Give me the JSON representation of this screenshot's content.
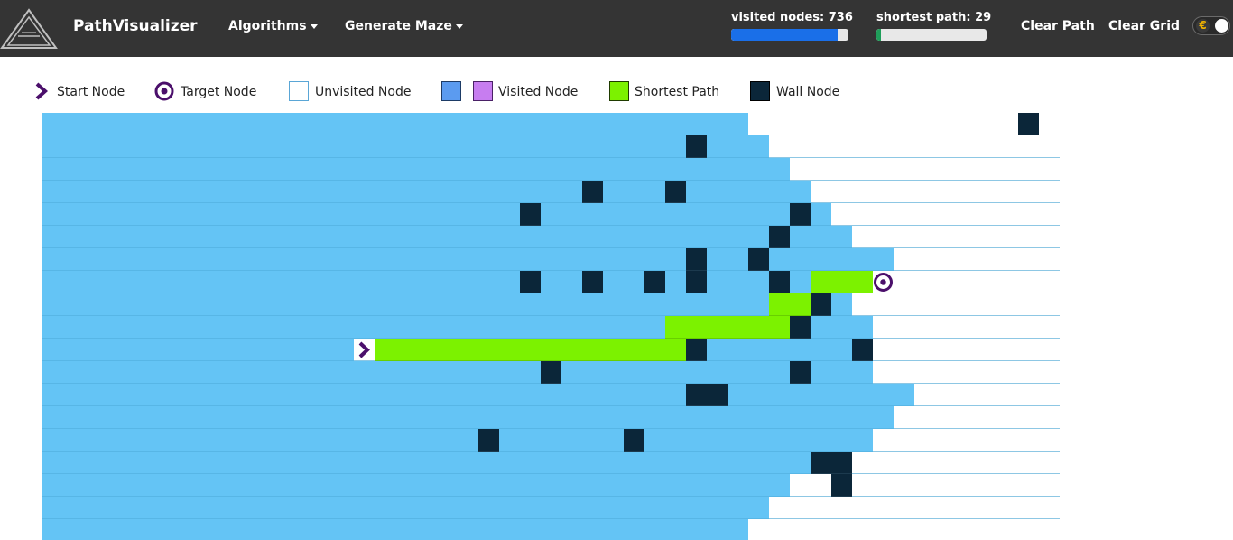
{
  "app": {
    "brand": "PathVisualizer",
    "logo_icon": "triangle-a-logo-icon"
  },
  "nav": {
    "algorithms": "Algorithms",
    "generate_maze": "Generate Maze",
    "clear_path": "Clear Path",
    "clear_grid": "Clear Grid",
    "theme_toggle_icon": "euro-coin-icon",
    "theme_toggle_state": "off"
  },
  "stats": {
    "visited_label": "visited nodes: 736",
    "visited_progress": 0.91,
    "visited_color": "#1a6fe8",
    "shortest_label": "shortest path: 29",
    "shortest_progress": 0.04,
    "shortest_color": "#1f9e5a"
  },
  "legend": {
    "start": "Start Node",
    "target": "Target Node",
    "unvisited": "Unvisited Node",
    "visited": "Visited Node",
    "shortest": "Shortest Path",
    "wall": "Wall Node"
  },
  "colors": {
    "navbar": "#343434",
    "visited_legend_a": "#5b9bf0",
    "visited_legend_b": "#c77df0",
    "visited_cell": "#64c4f5",
    "path": "#7cf200",
    "wall": "#0b2639",
    "start_target": "#4b0f6b"
  },
  "grid": {
    "cols": 49,
    "rows": 19,
    "visited_rows": [
      "VVVVVVVVVVVVVVVVVVVVVVVVVVVVVVVVVVU",
      "VVVVVVVVVVVVVVVVVVVVVVVVVVVVVVVVVVVU",
      "VVVVVVVVVVVVVVVVVVVVVVVVVVVVVVVVVVVVU",
      "VVVVVVVVVVVVVVVVVVVVVVVVVVVVVVVVVVVVVU",
      "VVVVVVVVVVVVVVVVVVVVVVVVVVVVVVVVVVVVVVU",
      "VVVVVVVVVVVVVVVVVVVVVVVVVVVVVVVVVVVVVVVU",
      "VVVVVVVVVVVVVVVVVVVVVVVVVVVVVVVVVVVVVVVVVU",
      "VVVVVVVVVVVVVVVVVVVVVVVVVVVVVVVVVVVVVVVVU",
      "VVVVVVVVVVVVVVVVVVVVVVVVVVVVVVVVVVVVVVVU",
      "VVVVVVVVVVVVVVVVVVVVVVVVVVVVVVVVVVVVVVVVU",
      "VVVVVVVVVVVVVVVVVVVVVVVVVVVVVVVVVVVVVVVVU",
      "VVVVVVVVVVVVVVVVVVVVVVVVVVVVVVVVVVVVVVVVU",
      "VVVVVVVVVVVVVVVVVVVVVVVVVVVVVVVVVVVVVVVVVVU",
      "VVVVVVVVVVVVVVVVVVVVVVVVVVVVVVVVVVVVVVVVVU",
      "VVVVVVVVVVVVVVVVVVVVVVVVVVVVVVVVVVVVVVVVU",
      "VVVVVVVVVVVVVVVVVVVVVVVVVVVVVVVVVVVVVVU",
      "VVVVVVVVVVVVVVVVVVVVVVVVVVVVVVVVVVVVU",
      "VVVVVVVVVVVVVVVVVVVVVVVVVVVVVVVVVVVU",
      "VVVVVVVVVVVVVVVVVVVVVVVVVVVVVVVVVVU"
    ],
    "walls": [
      [
        0,
        47
      ],
      [
        1,
        31
      ],
      [
        3,
        26
      ],
      [
        3,
        30
      ],
      [
        4,
        23
      ],
      [
        4,
        36
      ],
      [
        5,
        35
      ],
      [
        6,
        31
      ],
      [
        6,
        34
      ],
      [
        7,
        23
      ],
      [
        7,
        26
      ],
      [
        7,
        29
      ],
      [
        7,
        31
      ],
      [
        7,
        35
      ],
      [
        8,
        37
      ],
      [
        9,
        36
      ],
      [
        10,
        31
      ],
      [
        10,
        39
      ],
      [
        11,
        24
      ],
      [
        11,
        36
      ],
      [
        12,
        31
      ],
      [
        12,
        32
      ],
      [
        14,
        21
      ],
      [
        14,
        28
      ],
      [
        15,
        37
      ],
      [
        15,
        38
      ],
      [
        16,
        38
      ]
    ],
    "path": [
      [
        10,
        16
      ],
      [
        10,
        17
      ],
      [
        10,
        18
      ],
      [
        10,
        19
      ],
      [
        10,
        20
      ],
      [
        10,
        21
      ],
      [
        10,
        22
      ],
      [
        10,
        23
      ],
      [
        10,
        24
      ],
      [
        10,
        25
      ],
      [
        10,
        26
      ],
      [
        10,
        27
      ],
      [
        10,
        28
      ],
      [
        10,
        29
      ],
      [
        10,
        30
      ],
      [
        9,
        30
      ],
      [
        9,
        31
      ],
      [
        9,
        32
      ],
      [
        9,
        33
      ],
      [
        9,
        34
      ],
      [
        9,
        35
      ],
      [
        8,
        35
      ],
      [
        8,
        36
      ],
      [
        8,
        37
      ],
      [
        7,
        37
      ],
      [
        7,
        38
      ],
      [
        7,
        39
      ]
    ],
    "start": [
      10,
      15
    ],
    "target": [
      7,
      40
    ]
  }
}
